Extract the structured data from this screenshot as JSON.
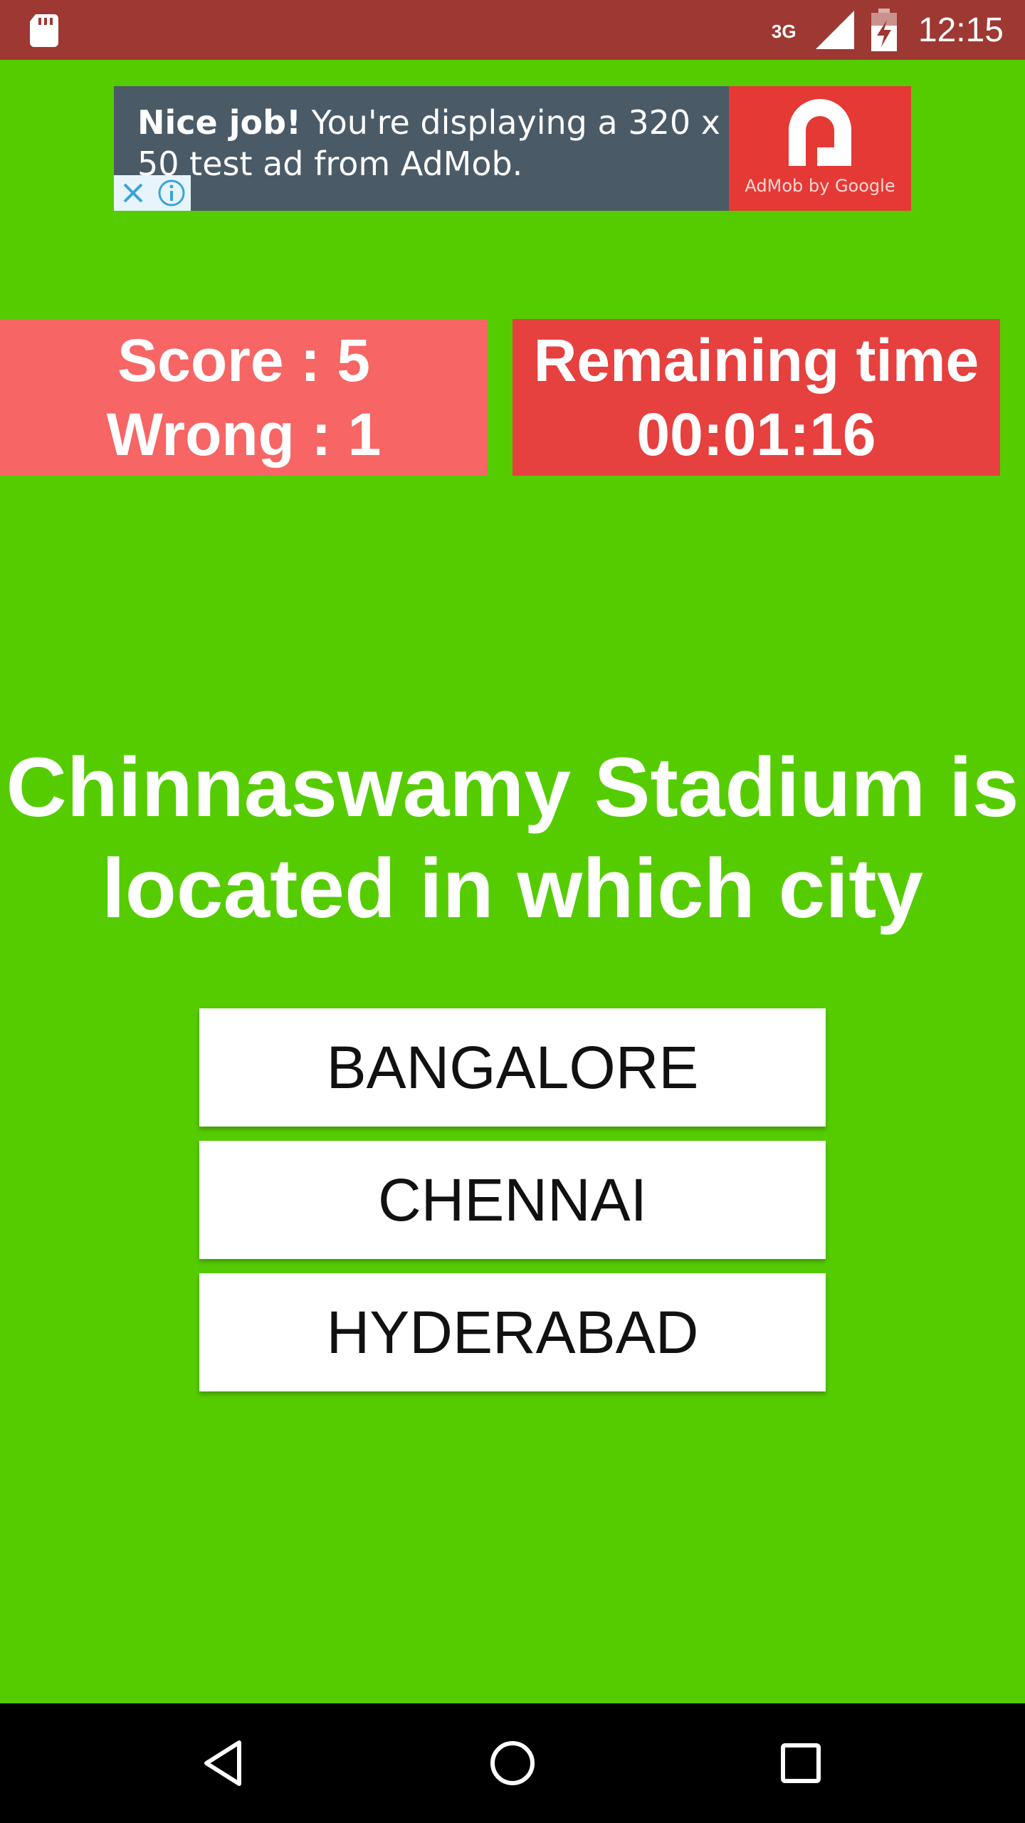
{
  "status_bar": {
    "network": "3G",
    "time": "12:15"
  },
  "ad": {
    "headline_bold": "Nice job!",
    "headline_rest": " You're displaying a 320 x 50 test ad from AdMob.",
    "logo_caption": "AdMob by Google"
  },
  "score": {
    "score_text": "Score : 5",
    "wrong_text": "Wrong : 1"
  },
  "timer": {
    "label": "Remaining time",
    "value": "00:01:16"
  },
  "question": "Chinnaswamy Stadium  is\nlocated in which city",
  "options": [
    "BANGALORE",
    "CHENNAI",
    "HYDERABAD"
  ],
  "colors": {
    "background": "#55cc00",
    "status_bar": "#9e3832",
    "score_box": "#f76565",
    "timer_box": "#e6403f"
  }
}
